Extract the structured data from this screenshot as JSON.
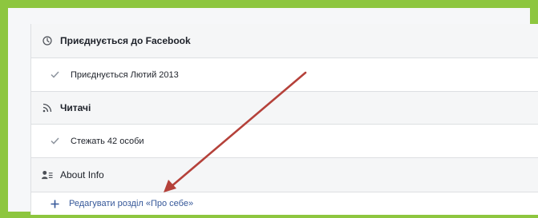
{
  "sections": {
    "joined": {
      "title": "Приєднується до Facebook",
      "item": "Приєднується Лютий 2013",
      "icon": "clock-icon",
      "item_icon": "check-icon"
    },
    "followers": {
      "title": "Читачі",
      "item": "Стежать 42 особи",
      "icon": "rss-icon",
      "item_icon": "check-icon"
    },
    "about": {
      "title": "About Info",
      "icon": "person-list-icon"
    }
  },
  "edit_link": {
    "label": "Редагувати розділ «Про себе»",
    "icon": "plus-icon"
  },
  "colors": {
    "frame": "#8dc63f",
    "link": "#365899",
    "arrow": "#b5413a",
    "header_bg": "#f5f6f7"
  }
}
